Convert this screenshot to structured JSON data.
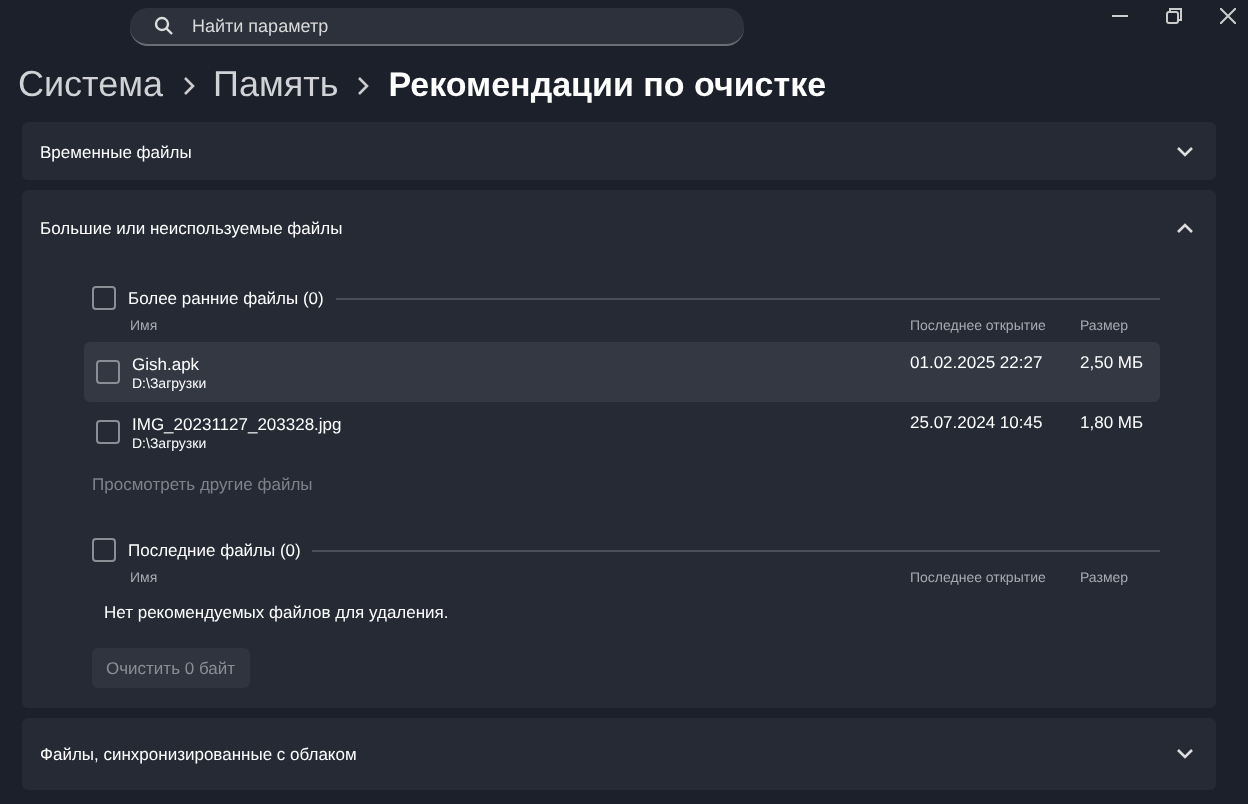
{
  "search": {
    "placeholder": "Найти параметр"
  },
  "breadcrumb": [
    "Система",
    "Память",
    "Рекомендации по очистке"
  ],
  "sections": [
    {
      "title": "Временные файлы",
      "expanded": false
    },
    {
      "title": "Большие или неиспользуемые файлы",
      "expanded": true,
      "groups": [
        {
          "title": "Более ранние файлы (0)",
          "checked": false,
          "columns": [
            "Имя",
            "Последнее открытие",
            "Размер"
          ],
          "files": [
            {
              "name": "Gish.apk",
              "path": "D:\\Загрузки",
              "date": "01.02.2025 22:27",
              "size": "2,50 МБ",
              "checked": false,
              "selected": true
            },
            {
              "name": "IMG_20231127_203328.jpg",
              "path": "D:\\Загрузки",
              "date": "25.07.2024 10:45",
              "size": "1,80 МБ",
              "checked": false,
              "selected": false
            }
          ],
          "more_link": "Просмотреть другие файлы"
        },
        {
          "title": "Последние файлы (0)",
          "checked": false,
          "columns": [
            "Имя",
            "Последнее открытие",
            "Размер"
          ],
          "empty_message": "Нет рекомендуемых файлов для удаления."
        }
      ],
      "button": {
        "label": "Очистить 0 байт",
        "disabled": true
      }
    },
    {
      "title": "Файлы, синхронизированные с облаком",
      "expanded": false
    }
  ]
}
